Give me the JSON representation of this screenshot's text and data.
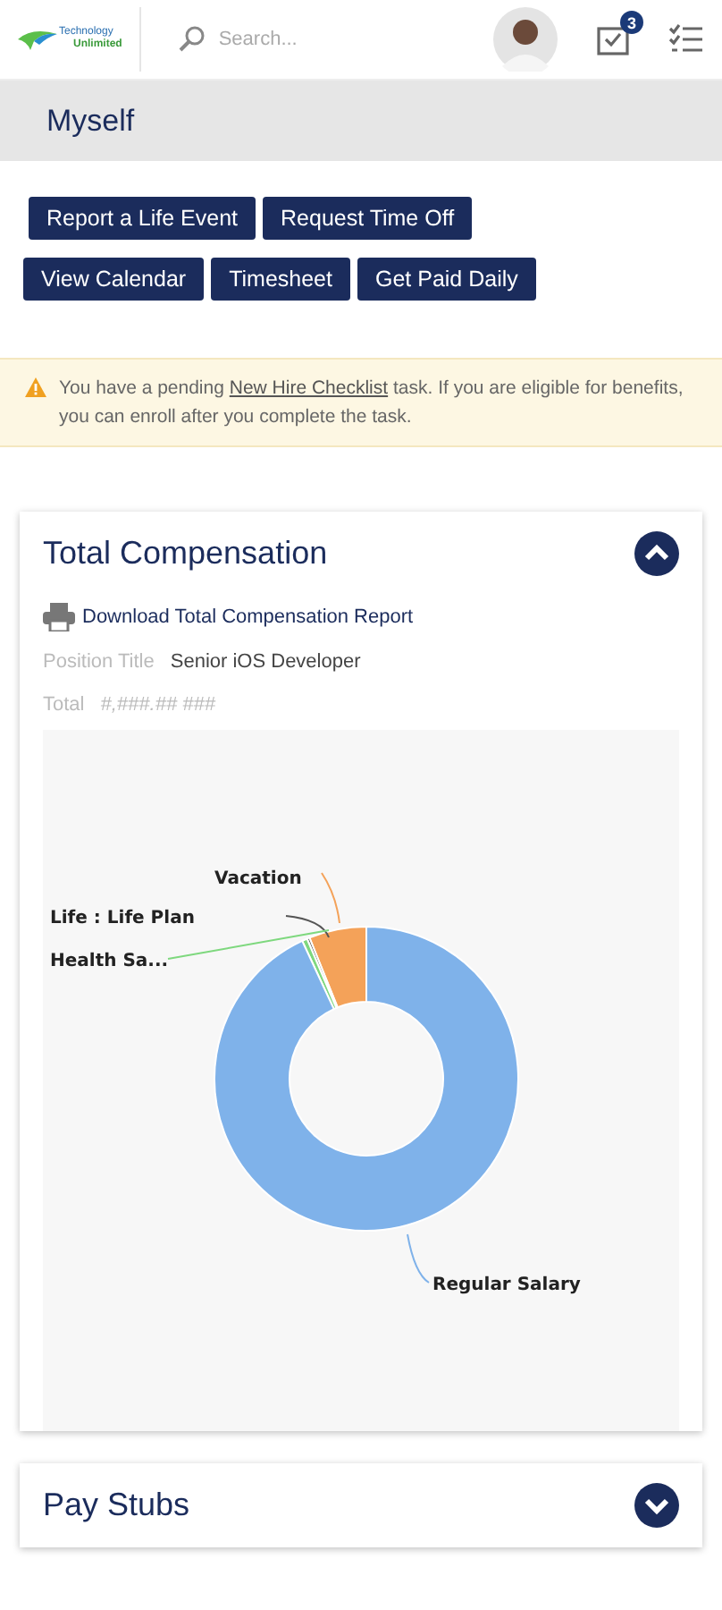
{
  "header": {
    "logo_text": [
      "Technology",
      "Unlimited"
    ],
    "search": {
      "placeholder": "Search..."
    },
    "badge": "3"
  },
  "page_title": "Myself",
  "action_rows": [
    [
      "Report a Life Event",
      "Request Time Off"
    ],
    [
      "View Calendar",
      "Timesheet",
      "Get Paid Daily"
    ]
  ],
  "alert": {
    "before": "You have a pending ",
    "link": "New Hire Checklist",
    "after": " task. If you are eligible for benefits, you can enroll after you complete the task."
  },
  "sections": [
    {
      "title": "Total Compensation",
      "expanded": true,
      "download": "Download Total Compensation Report",
      "fields": [
        {
          "label": "Position Title",
          "value": "Senior iOS Developer"
        },
        {
          "label": "Total",
          "value": "#,###.## ###"
        }
      ],
      "slices": [
        {
          "label": "Vacation",
          "color": "#f4a259"
        },
        {
          "label": "Life : Life Plan",
          "color": "#555555"
        },
        {
          "label": "Health Sa...",
          "color": "#7ed87e"
        },
        {
          "label": "Regular Salary",
          "color": "#7fb2ea"
        }
      ]
    },
    {
      "title": "Pay Stubs",
      "expanded": false
    }
  ]
}
